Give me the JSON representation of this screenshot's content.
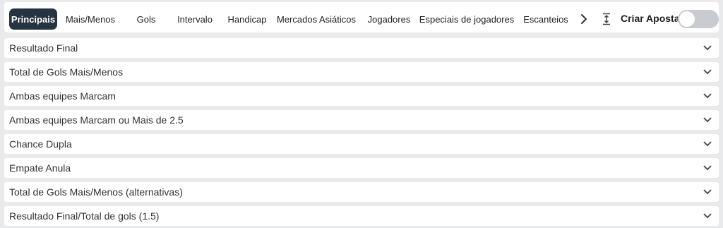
{
  "tabs": [
    {
      "label": "Principais",
      "active": true
    },
    {
      "label": "Mais/Menos"
    },
    {
      "label": "Gols"
    },
    {
      "label": "Intervalo"
    },
    {
      "label": "Handicap"
    },
    {
      "label": "Mercados Asiáticos"
    },
    {
      "label": "Jogadores"
    },
    {
      "label": "Especiais de jogadores"
    },
    {
      "label": "Escanteios"
    }
  ],
  "create_bet": {
    "label": "Criar Aposta",
    "toggle_on": false
  },
  "markets": [
    {
      "label": "Resultado Final"
    },
    {
      "label": "Total de Gols Mais/Menos"
    },
    {
      "label": "Ambas equipes Marcam"
    },
    {
      "label": "Ambas equipes Marcam ou Mais de 2.5"
    },
    {
      "label": "Chance Dupla"
    },
    {
      "label": "Empate Anula"
    },
    {
      "label": "Total de Gols Mais/Menos (alternativas)"
    },
    {
      "label": "Resultado Final/Total de gols (1.5)"
    }
  ],
  "colors": {
    "active_tab_bg": "#263340",
    "page_bg": "#e9eaec",
    "toggle_off": "#c8cbcf"
  }
}
